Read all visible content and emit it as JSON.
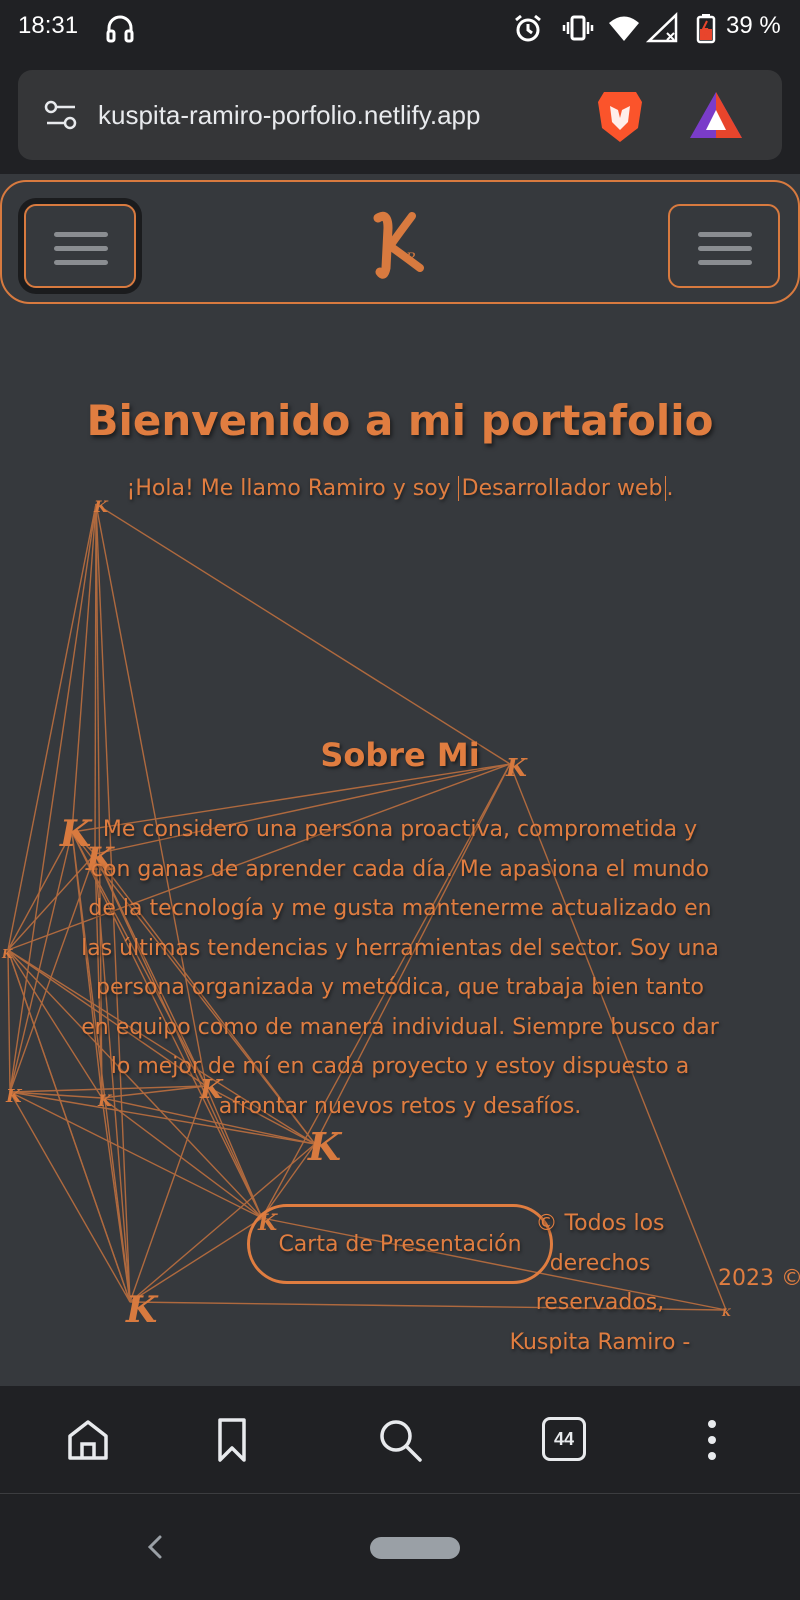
{
  "status_bar": {
    "time": "18:31",
    "battery": "39 %"
  },
  "browser": {
    "url": "kuspita-ramiro-porfolio.netlify.app",
    "tab_count": "44"
  },
  "hero": {
    "title": "Bienvenido a mi portafolio",
    "subtitle_prefix": "¡Hola! Me llamo Ramiro y soy ",
    "subtitle_typed": "Desarrollador web",
    "subtitle_suffix": "."
  },
  "about": {
    "title": "Sobre Mi",
    "text": "Me considero una persona proactiva, comprometida y con ganas de aprender cada día. Me apasiona el mundo de la tecnología y me gusta mantenerme actualizado en las últimas tendencias y herramientas del sector. Soy una persona organizada y metódica, que trabaja bien tanto en equipo como de manera individual. Siempre busco dar lo mejor de mí en cada proyecto y estoy dispuesto a afrontar nuevos retos y desafíos."
  },
  "cv_button": {
    "label": "Carta de Presentación"
  },
  "footer": {
    "text": "© Todos los derechos reservados, Kuspita Ramiro -",
    "year": "2023 ©"
  },
  "colors": {
    "accent": "#e07d40",
    "page_bg": "#36393d",
    "chrome_bg": "#202124"
  }
}
